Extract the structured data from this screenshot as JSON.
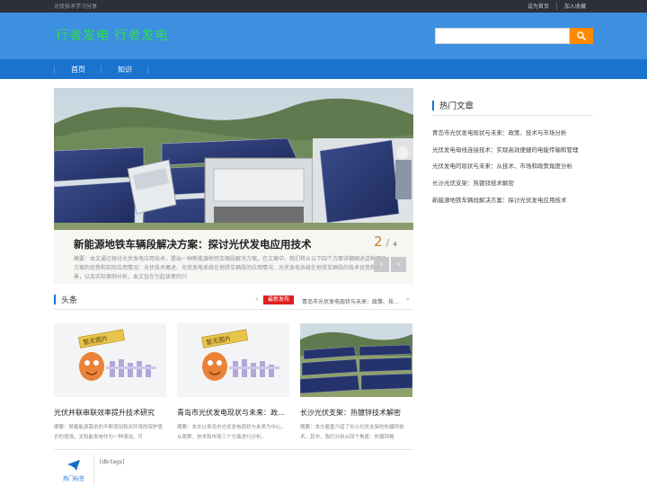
{
  "topbar": {
    "tagline": "光伏技术学习分享",
    "set_home": "设为首页",
    "add_favorite": "加入收藏"
  },
  "header": {
    "logo": "行者发电 行者发电",
    "search": {
      "placeholder": "",
      "value": ""
    }
  },
  "nav": {
    "items": [
      {
        "label": "首页"
      },
      {
        "label": "知识"
      }
    ]
  },
  "banner": {
    "title": "新能源地铁车辆段解决方案：探讨光伏发电应用技术",
    "desc": "摘要：本文通过探讨光伏发电应用技术，提出一种新能源地铁车辆段解决方案。在文章中，我们将从以下四个方面详细阐述这种解决方案的优势和实际应用情况：光伏技术概述、光伏发电系统在地铁车辆段的应用情况、光伏发电系统在地铁车辆段的技术优势和前景，以及实际案例分析。本文旨在引起读者的兴",
    "current": "2",
    "total": "4",
    "prev_arrow": "‹",
    "next_arrow": "›"
  },
  "headlines": {
    "label": "头条",
    "badge": "最新发布",
    "ticker": "青岛市光伏发电现状与未来：政策、技…",
    "prev": "«",
    "next": "»"
  },
  "cards": [
    {
      "title": "光伏并联串联效率提升技术研究",
      "desc": "摘要：随着能源需求的不断增加和对环境的保护意识的增强，太阳能发电作为一种清洁、可",
      "thumb": "placeholder",
      "thumb_label": "暂无图片"
    },
    {
      "title": "青岛市光伏发电现状与未来：政…",
      "desc": "摘要：本文以青岛市光伏发电现状与未来为中心，从政策、技术和市场三个方面进行分析。",
      "thumb": "placeholder",
      "thumb_label": "暂无图片"
    },
    {
      "title": "长沙光伏支架：热镀锌技术解密",
      "desc": "摘要：本文着重介绍了长沙光伏支架的热镀锌技术。其中，我们分别从四个角度：热镀锌概",
      "thumb": "photo"
    }
  ],
  "tags": {
    "label": "热门标签",
    "placeholder_text": "[db:tags]"
  },
  "sidebar": {
    "title": "热门文章",
    "items": [
      "青岛市光伏发电现状与未来：政策、技术与市场分析",
      "光伏发电母线连接技术：实现高效便捷的电能传输和管理",
      "光伏发电的现状与未来：从技术、市场和政策角度分析",
      "长沙光伏支架：热镀锌技术解密",
      "新能源地铁车辆段解决方案：探讨光伏发电应用技术"
    ]
  },
  "colors": {
    "topbar": "#2d3037",
    "header": "#3d8fe0",
    "nav": "#1a73cf",
    "logo": "#2ee04a",
    "search_button": "#ff8a00",
    "badge": "#e02020",
    "pager_current": "#d07b1d"
  },
  "icons": {
    "search": "search-icon",
    "tags": "paper-plane-icon"
  }
}
